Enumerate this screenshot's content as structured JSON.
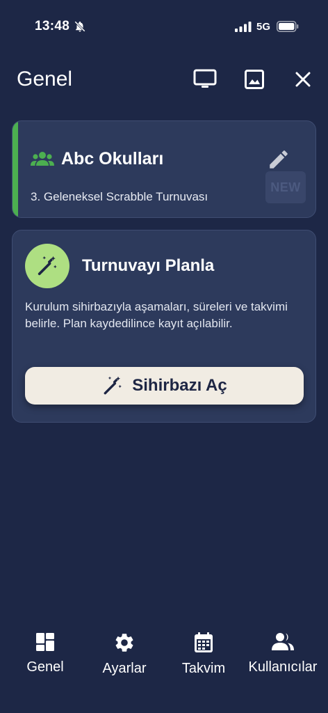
{
  "status_bar": {
    "time": "13:48",
    "network": "5G"
  },
  "header": {
    "title": "Genel"
  },
  "org_card": {
    "name": "Abc Okulları",
    "subtitle": "3. Geleneksel Scrabble Turnuvası",
    "badge": "NEW"
  },
  "plan_card": {
    "title": "Turnuvayı Planla",
    "description": "Kurulum sihirbazıyla aşamaları, süreleri ve takvimi belirle. Plan kaydedilince kayıt açılabilir.",
    "button_label": "Sihirbazı Aç"
  },
  "nav": [
    {
      "label": "Genel",
      "icon": "dashboard-icon"
    },
    {
      "label": "Ayarlar",
      "icon": "gear-icon"
    },
    {
      "label": "Takvim",
      "icon": "calendar-icon"
    },
    {
      "label": "Kullanıcılar",
      "icon": "users-icon"
    }
  ],
  "colors": {
    "background": "#1d2746",
    "card": "#2d3a5c",
    "accent_green": "#4caf50",
    "wizard_icon_bg": "#aedf82",
    "button_bg": "#f1ece3"
  }
}
